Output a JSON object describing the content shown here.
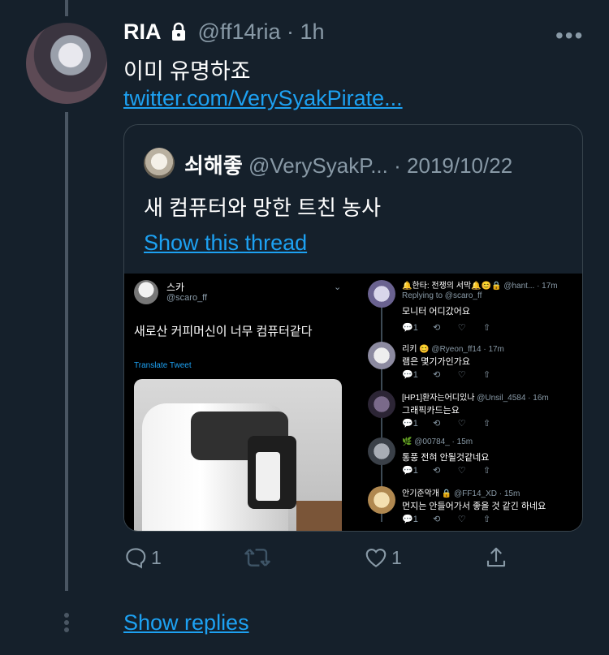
{
  "tweet": {
    "display_name": "RIA",
    "handle": "@ff14ria",
    "separator": "·",
    "time": "1h",
    "text": "이미 유명하죠",
    "link": "twitter.com/VerySyakPirate..."
  },
  "quoted": {
    "display_name": "쇠해좋",
    "handle": "@VerySyakP...",
    "separator": "·",
    "date": "2019/10/22",
    "text": "새 컴퓨터와 망한 트친 농사",
    "thread_link": "Show this thread"
  },
  "left_image": {
    "name": "스카",
    "handle": "@scaro_ff",
    "text": "새로산 커피머신이 너무 컴퓨터같다",
    "translate": "Translate Tweet"
  },
  "right_image": {
    "replies": [
      {
        "name": "🔔한타: 전쟁의 서막🔔😊🔒",
        "handle": "@hant...",
        "time": "17m",
        "sub": "Replying to @scaro_ff",
        "text": "모니터 어디갔어요",
        "count": "1"
      },
      {
        "name": "리키 😊",
        "handle": "@Ryeon_ff14",
        "time": "17m",
        "sub": "",
        "text": "램은 몇기가인가요",
        "count": "1"
      },
      {
        "name": "[HP1]환자는어디있나",
        "handle": "@Unsil_4584",
        "time": "16m",
        "sub": "",
        "text": "그래픽카드는요",
        "count": "1"
      },
      {
        "name": "🌿",
        "handle": "@00784_",
        "time": "15m",
        "sub": "",
        "text": "통풍 전혀 안될것같네요",
        "count": "1"
      },
      {
        "name": "안기준악개 🔒",
        "handle": "@FF14_XD",
        "time": "15m",
        "sub": "",
        "text": "먼지는 안들어가서 좋을 것 같긴 하네요",
        "count": "1"
      }
    ]
  },
  "actions": {
    "reply_count": "1",
    "retweet_count": "",
    "like_count": "1"
  },
  "show_replies": "Show replies",
  "colors": {
    "background": "#15202b",
    "accent": "#1da1f2",
    "muted": "#8899a6",
    "border": "#38444d"
  }
}
